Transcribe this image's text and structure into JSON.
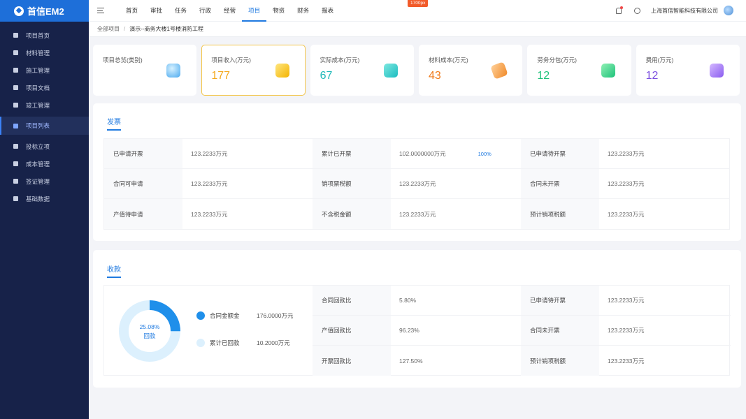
{
  "app": {
    "title": "首信EM2"
  },
  "sidebar": {
    "items": [
      {
        "label": "项目首页",
        "icon": "home-icon"
      },
      {
        "label": "材料管理",
        "icon": "box-icon"
      },
      {
        "label": "施工管理",
        "icon": "worker-icon"
      },
      {
        "label": "项目文档",
        "icon": "document-icon"
      },
      {
        "label": "竣工管理",
        "icon": "checklist-icon"
      },
      {
        "label": "项目列表",
        "icon": "grid-icon",
        "active": true
      },
      {
        "label": "投标立项",
        "icon": "target-icon"
      },
      {
        "label": "成本管理",
        "icon": "coin-icon"
      },
      {
        "label": "签证管理",
        "icon": "pie-icon"
      },
      {
        "label": "基础数据",
        "icon": "database-icon"
      }
    ]
  },
  "topnav": {
    "items": [
      "首页",
      "审批",
      "任务",
      "行政",
      "经营",
      "项目",
      "物资",
      "财务",
      "报表"
    ],
    "active_index": 5
  },
  "header": {
    "company": "上海首信智能科技有限公司",
    "width_badge": "1700px"
  },
  "breadcrumb": {
    "root": "全部项目",
    "separator": "/",
    "current": "演示--商务大楼1号楼消防工程"
  },
  "cards": [
    {
      "label": "项目总览(类别)",
      "value": "",
      "color": "#333333"
    },
    {
      "label": "项目收入(万元)",
      "value": "177",
      "color": "#f4a91d"
    },
    {
      "label": "实际成本(万元)",
      "value": "67",
      "color": "#1bb8b8"
    },
    {
      "label": "材料成本(万元)",
      "value": "43",
      "color": "#f07a1a"
    },
    {
      "label": "劳务分包(万元)",
      "value": "12",
      "color": "#1ec27a"
    },
    {
      "label": "费用(万元)",
      "value": "12",
      "color": "#7b4fe0"
    }
  ],
  "invoice": {
    "title": "发票",
    "rows": [
      [
        {
          "label": "已申请开票",
          "value": "123.2233万元"
        },
        {
          "label": "累计已开票",
          "value": "102.0000000万元",
          "pct": "100%"
        },
        {
          "label": "已申请待开票",
          "value": "123.2233万元"
        }
      ],
      [
        {
          "label": "合同可申请",
          "value": "123.2233万元"
        },
        {
          "label": "销项票税额",
          "value": "123.2233万元"
        },
        {
          "label": "合同未开票",
          "value": "123.2233万元"
        }
      ],
      [
        {
          "label": "产值待申请",
          "value": "123.2233万元"
        },
        {
          "label": "不含税金额",
          "value": "123.2233万元"
        },
        {
          "label": "预计销项税额",
          "value": "123.2233万元"
        }
      ]
    ]
  },
  "collection": {
    "title": "收款",
    "donut": {
      "percent": 25.08,
      "percent_label": "25.08%",
      "center_label": "回款",
      "colors": [
        "#1f8fea",
        "#dcf0fd"
      ]
    },
    "legend": [
      {
        "name": "合同金额金",
        "value": "176.0000万元",
        "color": "#1f8fea"
      },
      {
        "name": "累计已回款",
        "value": "10.2000万元",
        "color": "#dcf0fd"
      }
    ],
    "rows": [
      [
        {
          "label": "合同回款比",
          "value": "5.80%"
        },
        {
          "label": "已申请待开票",
          "value": "123.2233万元"
        }
      ],
      [
        {
          "label": "产值回款比",
          "value": "96.23%"
        },
        {
          "label": "合同未开票",
          "value": "123.2233万元"
        }
      ],
      [
        {
          "label": "开票回款比",
          "value": "127.50%"
        },
        {
          "label": "预计销项税额",
          "value": "123.2233万元"
        }
      ]
    ]
  }
}
